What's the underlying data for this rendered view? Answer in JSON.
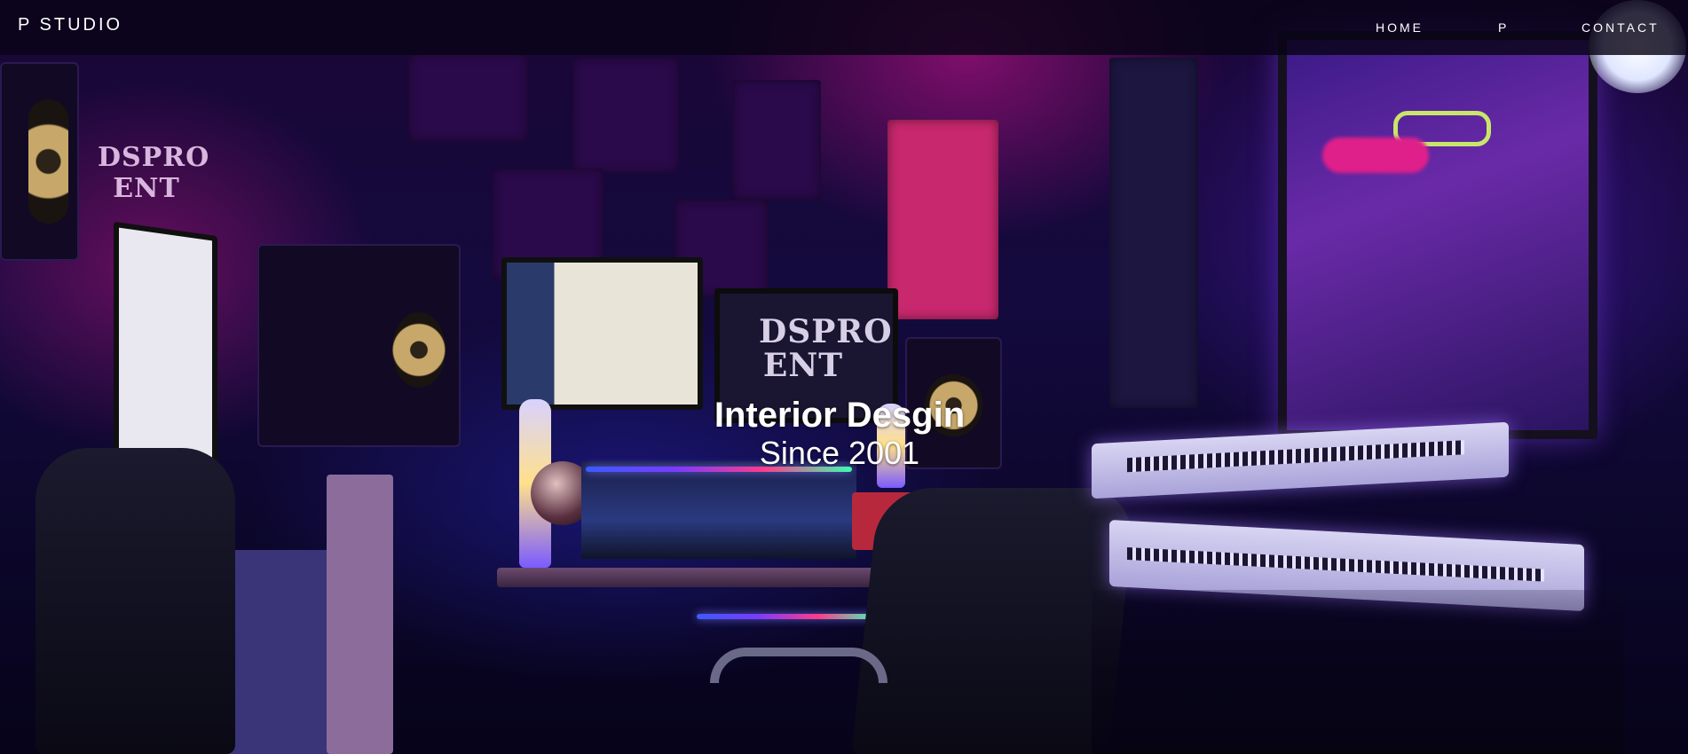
{
  "navbar": {
    "brand": "P STUDIO",
    "links": [
      {
        "label": "HOME"
      },
      {
        "label": "P"
      },
      {
        "label": "CONTACT"
      }
    ]
  },
  "hero": {
    "title": "Interior Desgin",
    "subtitle": "Since 2001",
    "poster_logo_text": "DSPRO ENT"
  },
  "colors": {
    "nav_background": "#080416",
    "text": "#ffffff",
    "neon_pink": "#d2148c",
    "neon_purple": "#5a1ec8"
  }
}
